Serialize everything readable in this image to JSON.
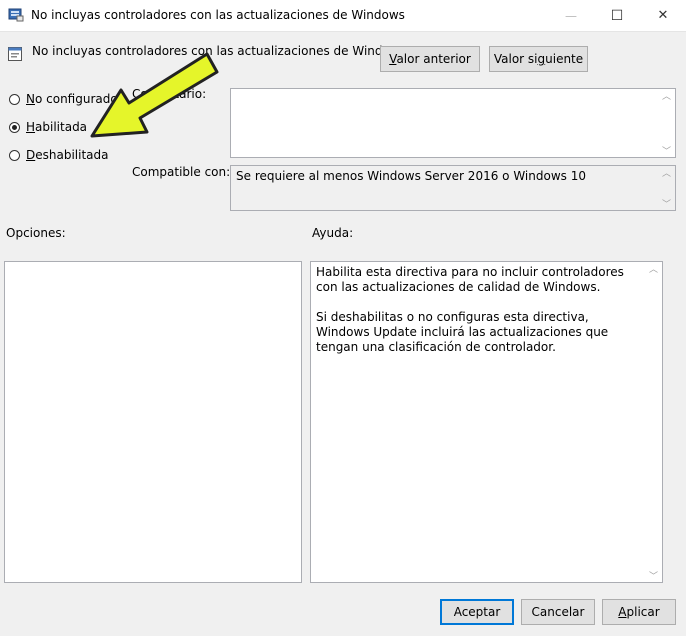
{
  "window": {
    "title": "No incluyas controladores con las actualizaciones de Windows",
    "controls": {
      "minimize": "—",
      "maximize": "☐",
      "close": "✕"
    }
  },
  "header": {
    "title": "No incluyas controladores con las actualizaciones de Windows",
    "prev_button": {
      "pre": "",
      "acc": "V",
      "post": "alor anterior"
    },
    "next_button": {
      "pre": "Valor si",
      "acc": "g",
      "post": "uiente"
    }
  },
  "state": {
    "options": [
      {
        "pre": "",
        "acc": "N",
        "post": "o configurado",
        "selected": false
      },
      {
        "pre": "",
        "acc": "H",
        "post": "abilitada",
        "selected": true
      },
      {
        "pre": "",
        "acc": "D",
        "post": "eshabilitada",
        "selected": false
      }
    ]
  },
  "comment": {
    "label": "Comentario:",
    "value": ""
  },
  "supported": {
    "label": "Compatible con:",
    "value": "Se requiere al menos Windows Server 2016 o Windows 10"
  },
  "options_panel": {
    "label": "Opciones:"
  },
  "help_panel": {
    "label": "Ayuda:",
    "paragraph1": "Habilita esta directiva para no incluir controladores con las actualizaciones de calidad de Windows.",
    "paragraph2": "Si deshabilitas o no configuras esta directiva, Windows Update incluirá las actualizaciones que tengan una clasificación de controlador."
  },
  "footer": {
    "ok": {
      "pre": "",
      "acc": "",
      "post": "Aceptar"
    },
    "cancel": {
      "pre": "",
      "acc": "",
      "post": "Cancelar"
    },
    "apply": {
      "pre": "",
      "acc": "A",
      "post": "plicar"
    }
  },
  "colors": {
    "accent": "#0078d7",
    "arrow_fill": "#e5f52a"
  },
  "icons": {
    "app": "policy-editor-icon",
    "header": "policy-setting-icon",
    "arrow": "yellow-pointer-arrow"
  }
}
